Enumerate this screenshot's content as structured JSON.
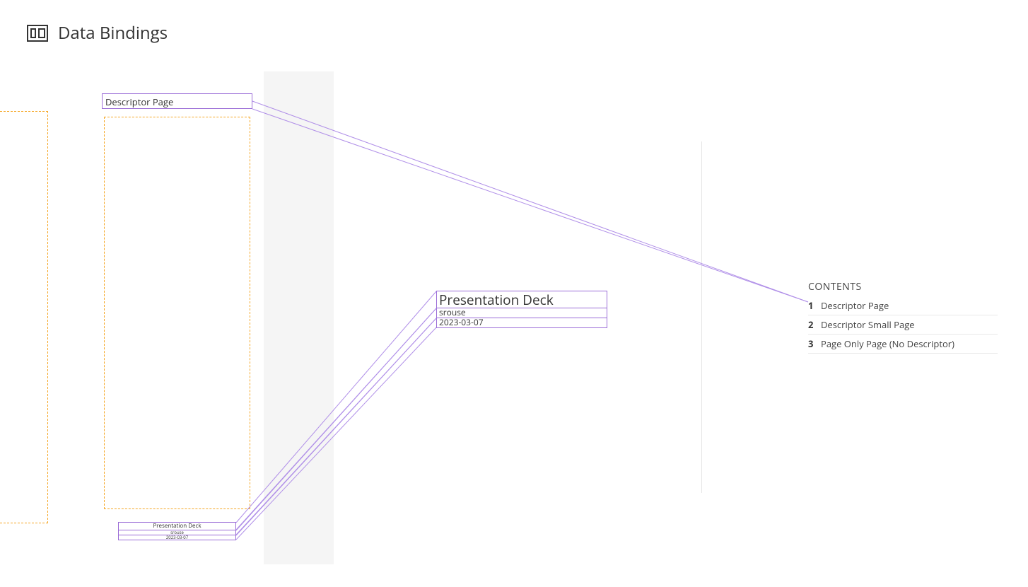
{
  "header": {
    "title": "Data Bindings"
  },
  "left_panel": {
    "descriptor_label": "Descriptor Page",
    "footer": {
      "title": "Presentation Deck",
      "author": "srouse",
      "date": "2023-03-07"
    }
  },
  "center": {
    "title": "Presentation Deck",
    "author": "srouse",
    "date": "2023-03-07"
  },
  "contents": {
    "heading": "CONTENTS",
    "items": [
      {
        "num": "1",
        "label": "Descriptor Page"
      },
      {
        "num": "2",
        "label": "Descriptor Small Page"
      },
      {
        "num": "3",
        "label": "Page Only Page (No Descriptor)"
      }
    ]
  }
}
